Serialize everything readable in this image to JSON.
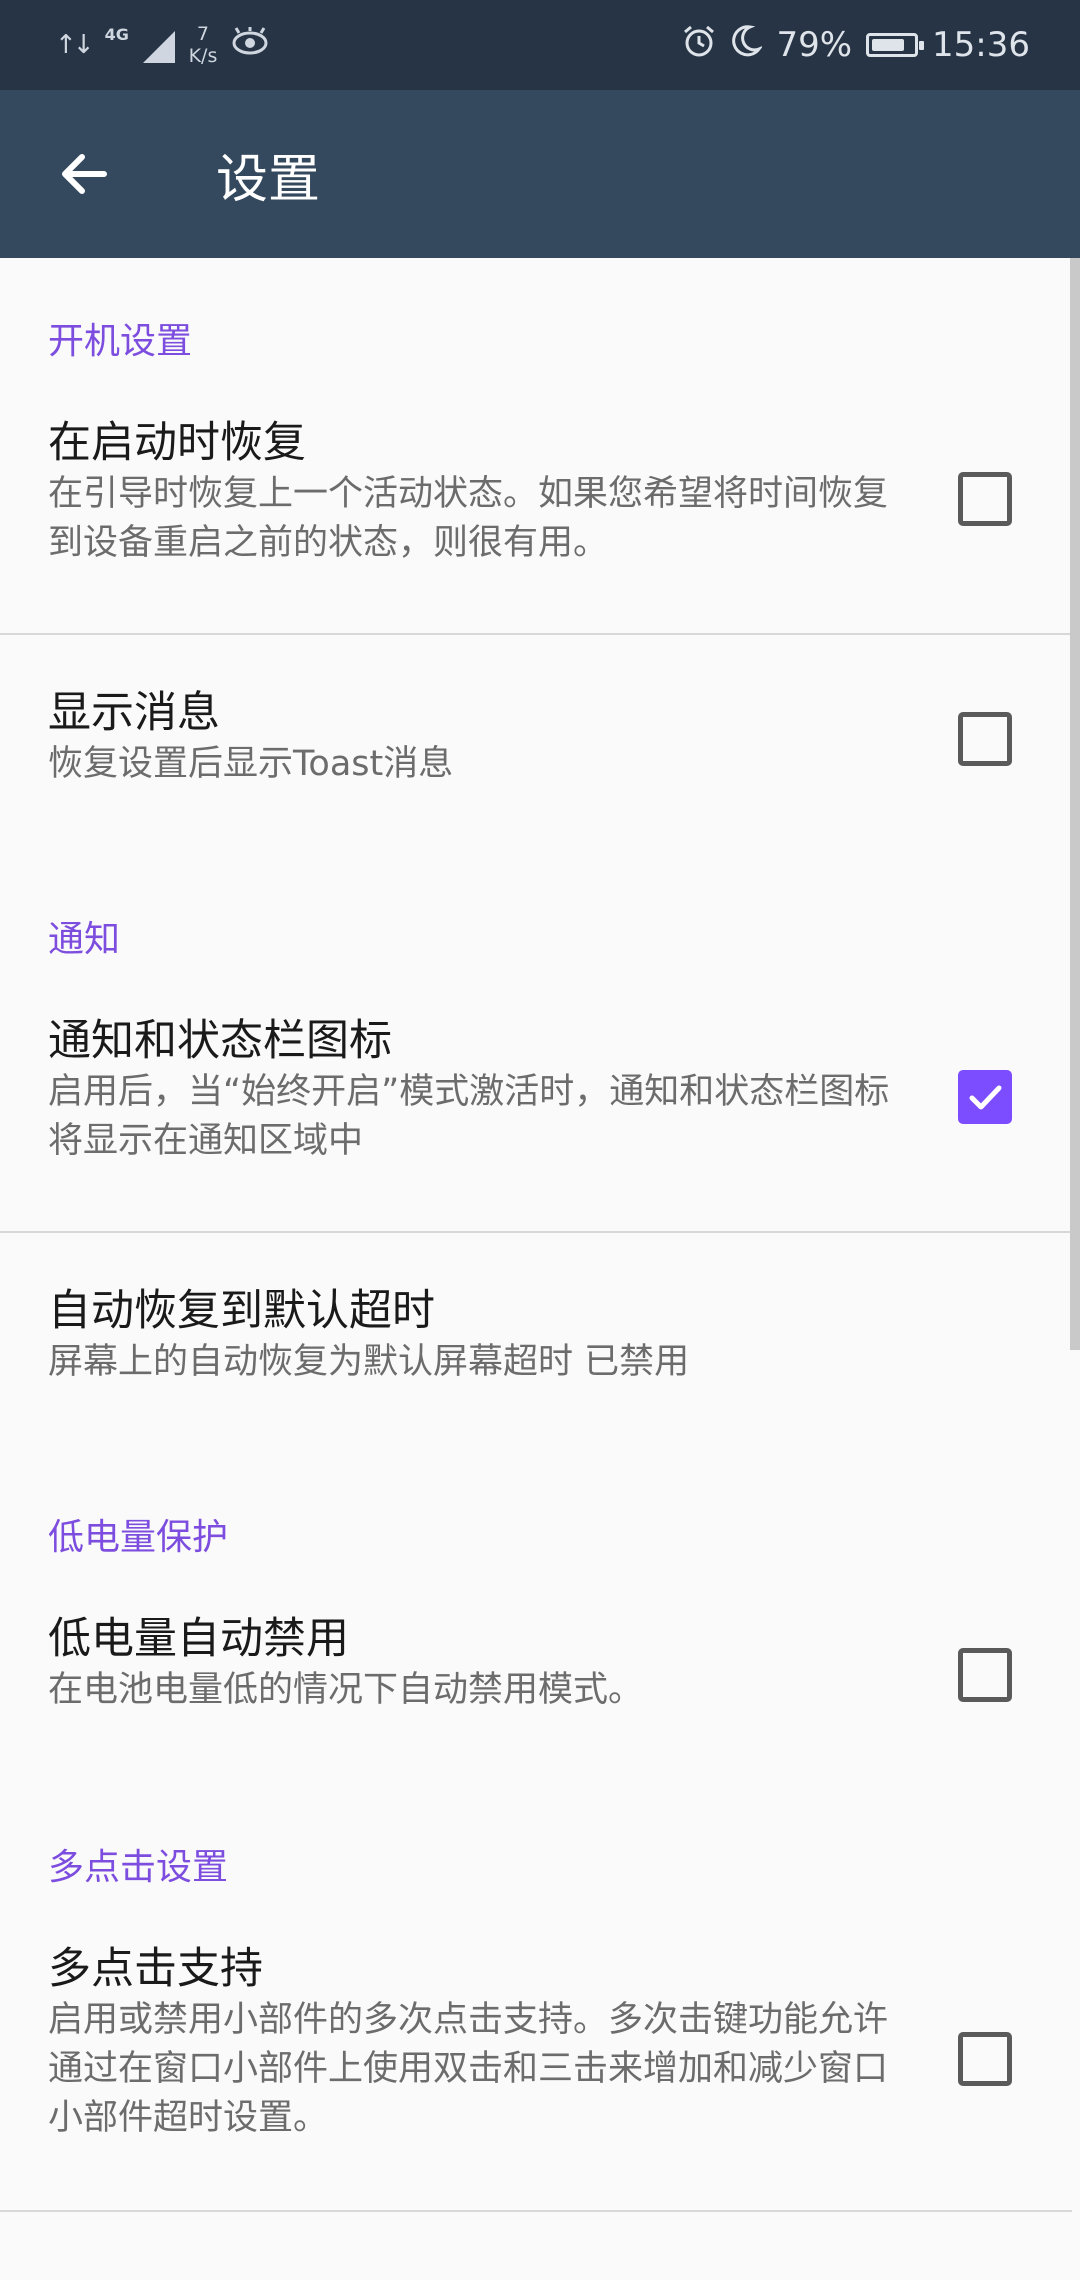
{
  "status_bar": {
    "network": "4G",
    "speed_value": "7",
    "speed_unit": "K/s",
    "battery_percent": "79%",
    "battery_level": 0.79,
    "time": "15:36",
    "icons": [
      "data-arrows-icon",
      "signal-icon",
      "eye-icon",
      "alarm-icon",
      "moon-icon",
      "battery-icon"
    ]
  },
  "app_bar": {
    "title": "设置",
    "back_icon": "back-arrow-icon",
    "color": "#34495e"
  },
  "accent_color": "#7c4dff",
  "sections": [
    {
      "header": "开机设置",
      "items": [
        {
          "title": "在启动时恢复",
          "summary": "在引导时恢复上一个活动状态。如果您希望将时间恢复到设备重启之前的状态，则很有用。",
          "checked": false
        },
        {
          "title": "显示消息",
          "summary": "恢复设置后显示Toast消息",
          "checked": false
        }
      ]
    },
    {
      "header": "通知",
      "items": [
        {
          "title": "通知和状态栏图标",
          "summary": "启用后，当“始终开启”模式激活时，通知和状态栏图标将显示在通知区域中",
          "checked": true
        },
        {
          "title": "自动恢复到默认超时",
          "summary": "屏幕上的自动恢复为默认屏幕超时 已禁用"
        }
      ]
    },
    {
      "header": "低电量保护",
      "items": [
        {
          "title": "低电量自动禁用",
          "summary": "在电池电量低的情况下自动禁用模式。",
          "checked": false
        }
      ]
    },
    {
      "header": "多点击设置",
      "items": [
        {
          "title": "多点击支持",
          "summary": "启用或禁用小部件的多次点击支持。多次击键功能允许通过在窗口小部件上使用双击和三击来增加和减少窗口小部件超时设置。",
          "checked": false
        }
      ]
    }
  ]
}
